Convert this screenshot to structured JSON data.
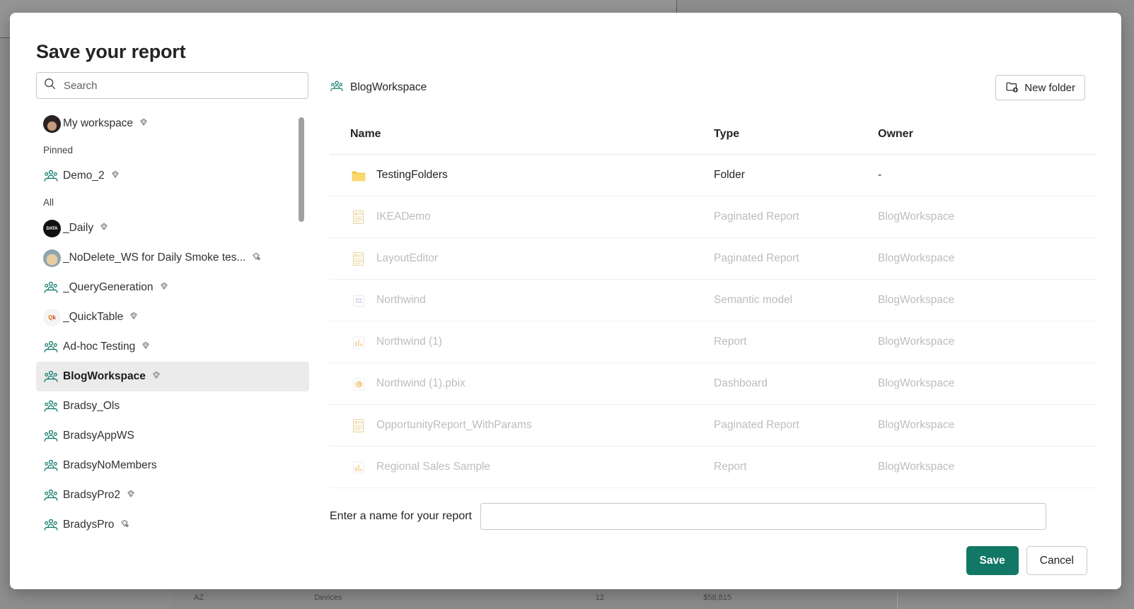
{
  "background": {
    "row": {
      "state": "AZ",
      "category": "Devices",
      "count": "12",
      "amount": "$58,815"
    }
  },
  "dialog": {
    "title": "Save your report",
    "search": {
      "placeholder": "Search",
      "value": "",
      "icon": "search-icon"
    },
    "sidebar": {
      "items": [
        {
          "label": "My workspace",
          "icon": "avatar-photo",
          "gem": "diamond-icon",
          "type": "personal",
          "selected": false
        },
        {
          "label": "Pinned",
          "type": "group-header"
        },
        {
          "label": "Demo_2",
          "icon": "workspace-people-icon",
          "gem": "diamond-icon",
          "type": "workspace",
          "selected": false
        },
        {
          "label": "All",
          "type": "group-header"
        },
        {
          "label": "_Daily",
          "icon": "avatar-dark",
          "gem": "diamond-icon",
          "type": "workspace",
          "selected": false
        },
        {
          "label": "_NoDelete_WS for Daily Smoke tes...",
          "icon": "avatar-dog",
          "gem": "diamond-network-icon",
          "type": "workspace",
          "selected": false
        },
        {
          "label": "_QueryGeneration",
          "icon": "workspace-people-icon",
          "gem": "diamond-icon",
          "type": "workspace",
          "selected": false
        },
        {
          "label": "_QuickTable",
          "icon": "avatar-quick",
          "gem": "diamond-icon",
          "type": "workspace",
          "selected": false
        },
        {
          "label": "Ad-hoc Testing",
          "icon": "workspace-people-icon",
          "gem": "diamond-icon",
          "type": "workspace",
          "selected": false
        },
        {
          "label": "BlogWorkspace",
          "icon": "workspace-people-icon",
          "gem": "diamond-icon",
          "type": "workspace",
          "selected": true
        },
        {
          "label": "Bradsy_Ols",
          "icon": "workspace-people-icon",
          "gem": null,
          "type": "workspace",
          "selected": false
        },
        {
          "label": "BradsyAppWS",
          "icon": "workspace-people-icon",
          "gem": null,
          "type": "workspace",
          "selected": false
        },
        {
          "label": "BradsyNoMembers",
          "icon": "workspace-people-icon",
          "gem": null,
          "type": "workspace",
          "selected": false
        },
        {
          "label": "BradsyPro2",
          "icon": "workspace-people-icon",
          "gem": "diamond-icon",
          "type": "workspace",
          "selected": false
        },
        {
          "label": "BradysPro",
          "icon": "workspace-people-icon",
          "gem": "diamond-network-icon",
          "type": "workspace",
          "selected": false
        }
      ]
    },
    "breadcrumb": {
      "label": "BlogWorkspace",
      "icon": "workspace-people-icon"
    },
    "new_folder_button": {
      "label": "New folder",
      "icon": "new-folder-icon"
    },
    "grid": {
      "columns": [
        "Name",
        "Type",
        "Owner"
      ],
      "rows": [
        {
          "name": "TestingFolders",
          "type": "Folder",
          "owner": "-",
          "icon": "folder-icon",
          "disabled": false
        },
        {
          "name": "IKEADemo",
          "type": "Paginated Report",
          "owner": "BlogWorkspace",
          "icon": "paginated-report-icon",
          "disabled": true
        },
        {
          "name": "LayoutEditor",
          "type": "Paginated Report",
          "owner": "BlogWorkspace",
          "icon": "paginated-report-icon",
          "disabled": true
        },
        {
          "name": "Northwind",
          "type": "Semantic model",
          "owner": "BlogWorkspace",
          "icon": "semantic-model-icon",
          "disabled": true
        },
        {
          "name": "Northwind (1)",
          "type": "Report",
          "owner": "BlogWorkspace",
          "icon": "report-icon",
          "disabled": true
        },
        {
          "name": "Northwind (1).pbix",
          "type": "Dashboard",
          "owner": "BlogWorkspace",
          "icon": "dashboard-icon",
          "disabled": true
        },
        {
          "name": "OpportunityReport_WithParams",
          "type": "Paginated Report",
          "owner": "BlogWorkspace",
          "icon": "paginated-report-icon",
          "disabled": true
        },
        {
          "name": "Regional Sales Sample",
          "type": "Report",
          "owner": "BlogWorkspace",
          "icon": "report-icon",
          "disabled": true
        }
      ]
    },
    "name_field": {
      "label": "Enter a name for your report",
      "value": "",
      "placeholder": ""
    },
    "actions": {
      "save": "Save",
      "cancel": "Cancel"
    },
    "colors": {
      "accent": "#117865",
      "selected_row_bg": "#ebebeb",
      "folder_icon": "#f2c230"
    }
  }
}
